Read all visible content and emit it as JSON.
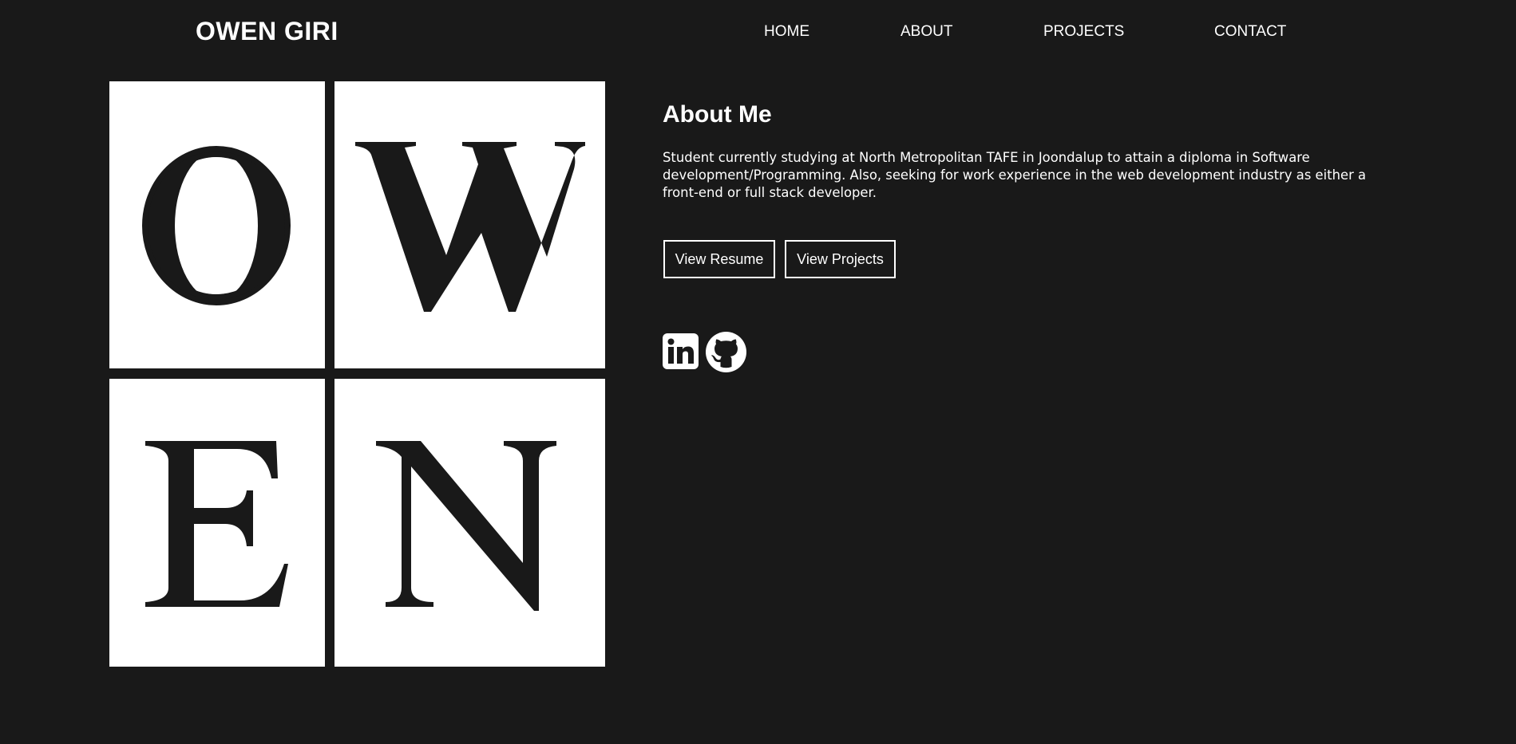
{
  "header": {
    "brand": "OWEN GIRI",
    "nav": [
      {
        "label": "HOME"
      },
      {
        "label": "ABOUT"
      },
      {
        "label": "PROJECTS"
      },
      {
        "label": "CONTACT"
      }
    ]
  },
  "tiles": {
    "letters": [
      "O",
      "W",
      "E",
      "N"
    ]
  },
  "about": {
    "title": "About Me",
    "text": "Student currently studying at North Metropolitan TAFE in Joondalup to attain a diploma in Software development/Programming. Also, seeking for work experience in the web development industry as either a front-end or full stack developer.",
    "buttons": {
      "resume": "View Resume",
      "projects": "View Projects"
    }
  },
  "social": {
    "icons": [
      "linkedin-icon",
      "github-icon"
    ]
  },
  "colors": {
    "background": "#191919",
    "text": "#ffffff",
    "tile": "#ffffff",
    "letter": "#191919"
  }
}
